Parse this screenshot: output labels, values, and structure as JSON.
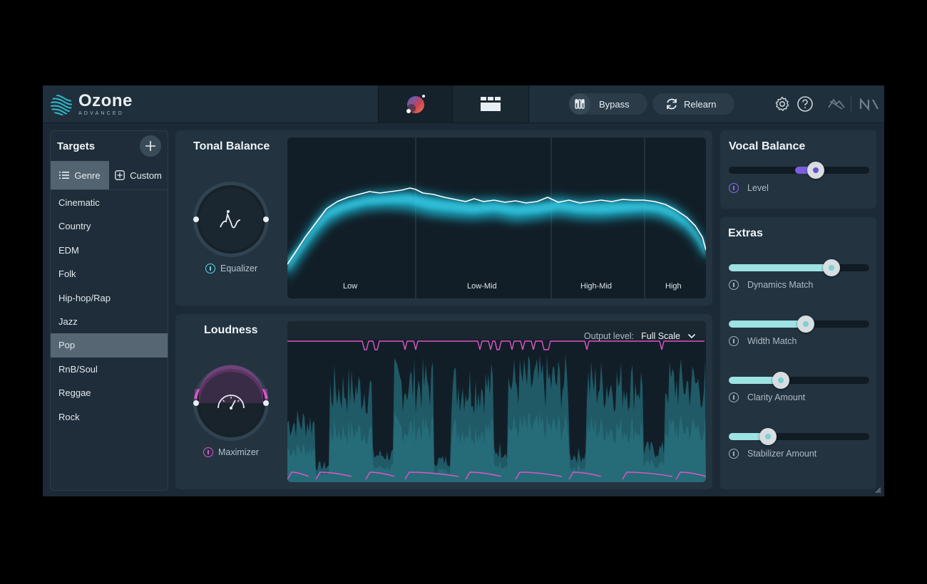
{
  "header": {
    "logo_name": "Ozone",
    "logo_sub": "ADVANCED",
    "bypass_label": "Bypass",
    "relearn_label": "Relearn",
    "icons": [
      "assistant-icon",
      "modules-icon",
      "bypass-icon",
      "relearn-icon",
      "gear-icon",
      "help-icon",
      "izotope-icon",
      "ni-logo-icon"
    ]
  },
  "targets": {
    "title": "Targets",
    "tabs": {
      "genre": "Genre",
      "custom": "Custom"
    },
    "active_tab": "Genre",
    "genres": [
      "Cinematic",
      "Country",
      "EDM",
      "Folk",
      "Hip-hop/Rap",
      "Jazz",
      "Pop",
      "RnB/Soul",
      "Reggae",
      "Rock"
    ],
    "selected": "Pop"
  },
  "tonal_balance": {
    "title": "Tonal Balance",
    "knob_label": "Equalizer",
    "bands": [
      "Low",
      "Low-Mid",
      "High-Mid",
      "High"
    ]
  },
  "loudness": {
    "title": "Loudness",
    "knob_label": "Maximizer",
    "output_level_label": "Output level:",
    "output_level_value": "Full Scale"
  },
  "vocal_balance": {
    "title": "Vocal Balance",
    "level_label": "Level",
    "level_value": 0.62
  },
  "extras": {
    "title": "Extras",
    "sliders": [
      {
        "label": "Dynamics Match",
        "value": 0.73
      },
      {
        "label": "Width Match",
        "value": 0.55
      },
      {
        "label": "Clarity Amount",
        "value": 0.37
      },
      {
        "label": "Stabilizer Amount",
        "value": 0.28
      }
    ]
  },
  "colors": {
    "accent_cyan": "#5fd3e6",
    "accent_pink": "#e054c9",
    "accent_purple": "#7b5fdc",
    "slider_fill": "#9ee3e3"
  }
}
